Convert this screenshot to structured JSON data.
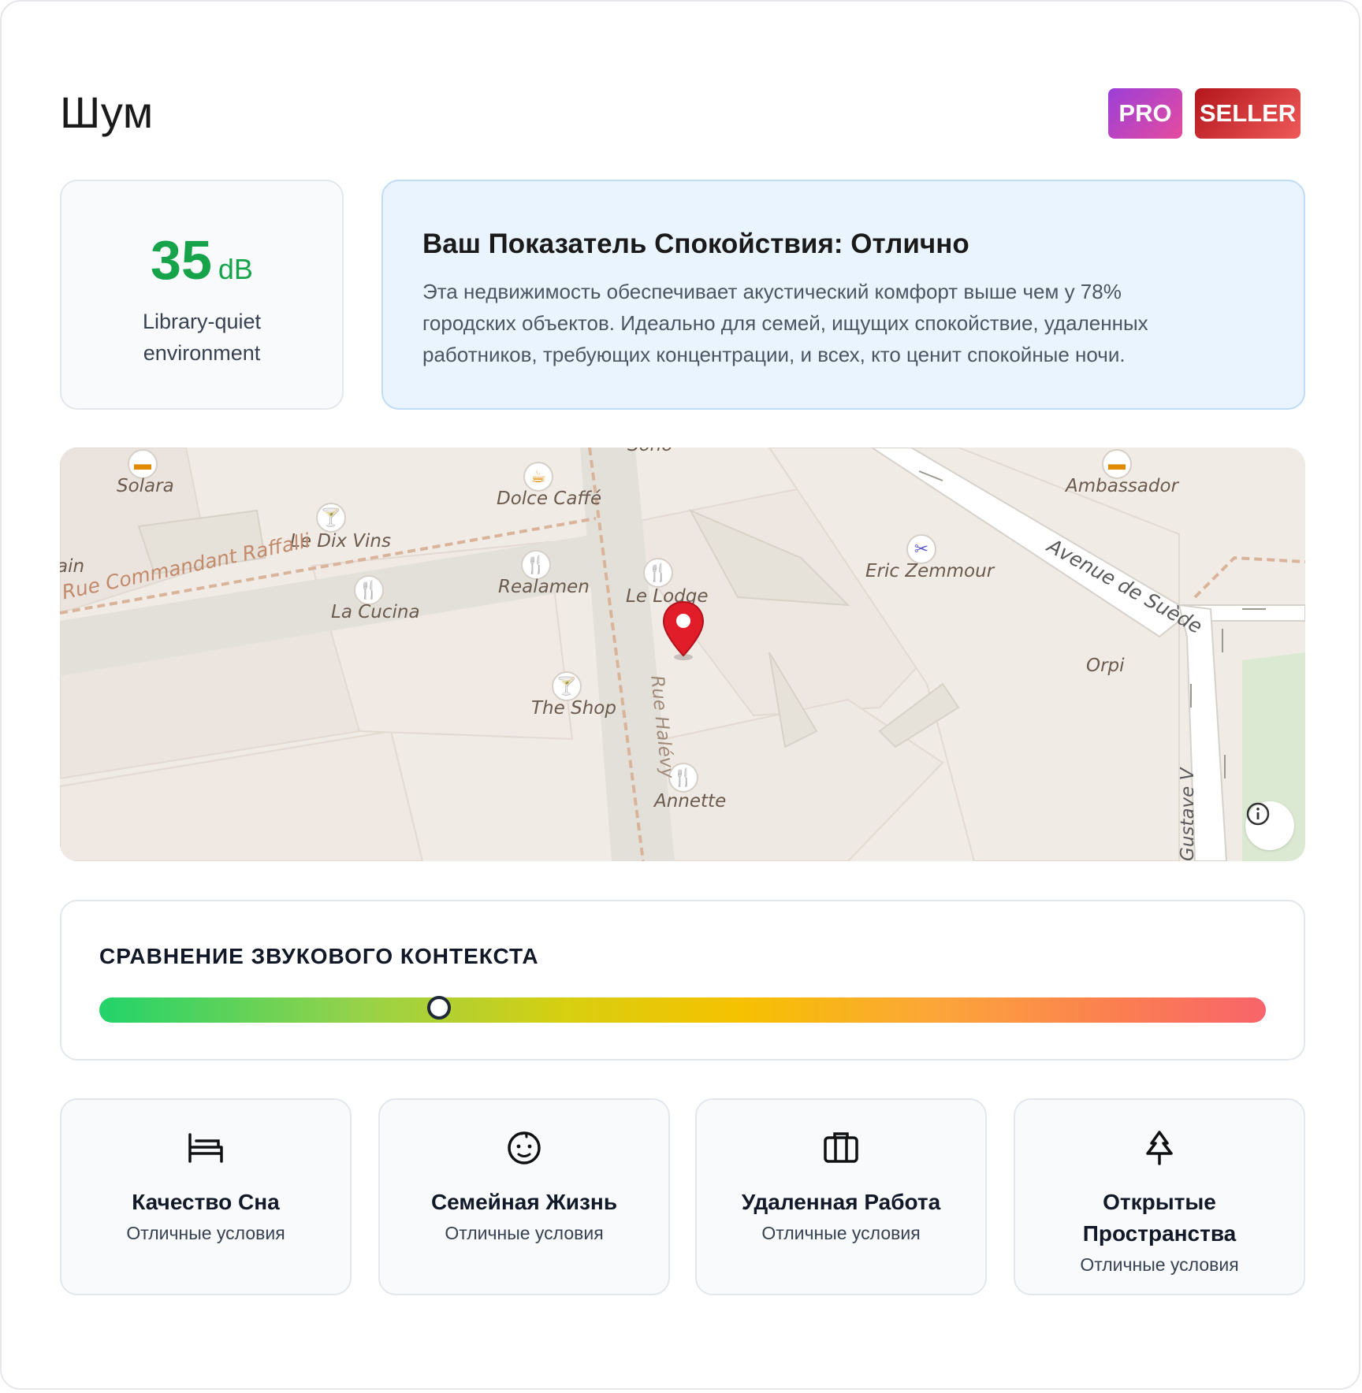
{
  "page": {
    "title": "Шум"
  },
  "badges": {
    "pro": "PRO",
    "seller": "SELLER"
  },
  "noise": {
    "value": "35",
    "unit": "dB",
    "description": "Library-quiet environment"
  },
  "peace": {
    "title": "Ваш Показатель Спокойствия: Отлично",
    "text": "Эта недвижимость обеспечивает акустический комфорт выше чем у 78% городских объектов. Идеально для семей, ищущих спокойствие, удаленных работников, требующих концентрации, и всех, кто ценит спокойные ночи."
  },
  "map": {
    "labels": {
      "solara": "Solara",
      "le_dix_vins": "Le Dix Vins",
      "dolce_caffe": "Dolce Caffé",
      "realamen": "Realamen",
      "la_cucina": "La Cucina",
      "le_lodge": "Le Lodge",
      "the_shop": "The Shop",
      "annette": "Annette",
      "ambassador": "Ambassador",
      "eric_zemmour": "Eric Zemmour",
      "orpi": "Orpi",
      "street_raffalli": "Rue Commandant Raffalli",
      "street_halevy": "Rue Halévy",
      "street_suede": "Avenue de Suède",
      "street_gustave": "Gustave V",
      "soho": "Soho",
      "edge_left": "ain"
    }
  },
  "comparison": {
    "title": "СРАВНЕНИЕ ЗВУКОВОГО КОНТЕКСТА",
    "marker_fraction": 0.291
  },
  "features": [
    {
      "icon": "bed-icon",
      "title": "Качество Сна",
      "subtitle": "Отличные условия"
    },
    {
      "icon": "baby-face-icon",
      "title": "Семейная Жизнь",
      "subtitle": "Отличные условия"
    },
    {
      "icon": "briefcase-icon",
      "title": "Удаленная Работа",
      "subtitle": "Отличные условия"
    },
    {
      "icon": "tree-icon",
      "title": "Открытые Пространства",
      "subtitle": "Отличные условия"
    }
  ]
}
